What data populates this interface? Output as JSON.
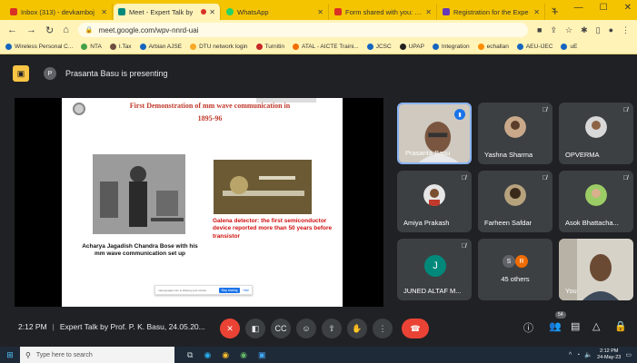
{
  "browser": {
    "tabs": [
      {
        "label": "Inbox (313) - devkamboj",
        "favicon_color": "#d93025"
      },
      {
        "label": "Meet - Expert Talk by",
        "favicon_color": "#00897b",
        "active": true,
        "recording": true
      },
      {
        "label": "WhatsApp",
        "favicon_color": "#25d366"
      },
      {
        "label": "Form shared with you: Re",
        "favicon_color": "#d93025"
      },
      {
        "label": "Registration for the Expe",
        "favicon_color": "#673ab7"
      }
    ],
    "new_tab": "+",
    "url": "meet.google.com/wpv-nnrd-uai",
    "bookmarks": [
      {
        "label": "Wireless Personal C...",
        "color": "#1565c0"
      },
      {
        "label": "NTA",
        "color": "#43a047"
      },
      {
        "label": "I.Tax",
        "color": "#6d4c41"
      },
      {
        "label": "Arbian AJSE",
        "color": "#1565c0"
      },
      {
        "label": "DTU network login",
        "color": "#f9a825"
      },
      {
        "label": "Turnitin",
        "color": "#c62828"
      },
      {
        "label": "ATAL - AICTE Traini...",
        "color": "#ef6c00"
      },
      {
        "label": "JCSC",
        "color": "#1565c0"
      },
      {
        "label": "UPAP",
        "color": "#212121"
      },
      {
        "label": "Integration",
        "color": "#1565c0"
      },
      {
        "label": "echallan",
        "color": "#fb8c00"
      },
      {
        "label": "AEU-IJEC",
        "color": "#1565c0"
      },
      {
        "label": "uE",
        "color": "#1565c0"
      }
    ]
  },
  "meet": {
    "presenter_initial": "P",
    "presenting_text": "Prasanta Basu is presenting",
    "slide": {
      "title": "First Demonstration of mm wave communication in",
      "year": "1895-96",
      "caption_left": "Acharya Jagadish Chandra Bose with his mm wave communication set up",
      "caption_right": "Galena detector: the first semiconductor device reported more than 50 years before transistor",
      "share_bar_text": "meet.google.com is sharing your screen",
      "stop_sharing": "Stop sharing",
      "hide": "Hide"
    },
    "participants": [
      {
        "name": "Prasanta Basu",
        "speaking": true
      },
      {
        "name": "Yashna Sharma"
      },
      {
        "name": "OPVERMA"
      },
      {
        "name": "Amiya Prakash"
      },
      {
        "name": "Farheen Safdar"
      },
      {
        "name": "Asok Bhattacha..."
      },
      {
        "name": "JUNED ALTAF M...",
        "initial": "J"
      },
      {
        "name": "45 others",
        "initials": [
          "S",
          "R"
        ]
      },
      {
        "name": "You"
      }
    ],
    "time": "2:12 PM",
    "meeting_title": "Expert Talk by Prof. P. K. Basu, 24.05.20...",
    "participant_count": "54"
  },
  "taskbar": {
    "search_placeholder": "Type here to search",
    "clock_time": "2:12 PM",
    "clock_date": "24-May-23"
  }
}
